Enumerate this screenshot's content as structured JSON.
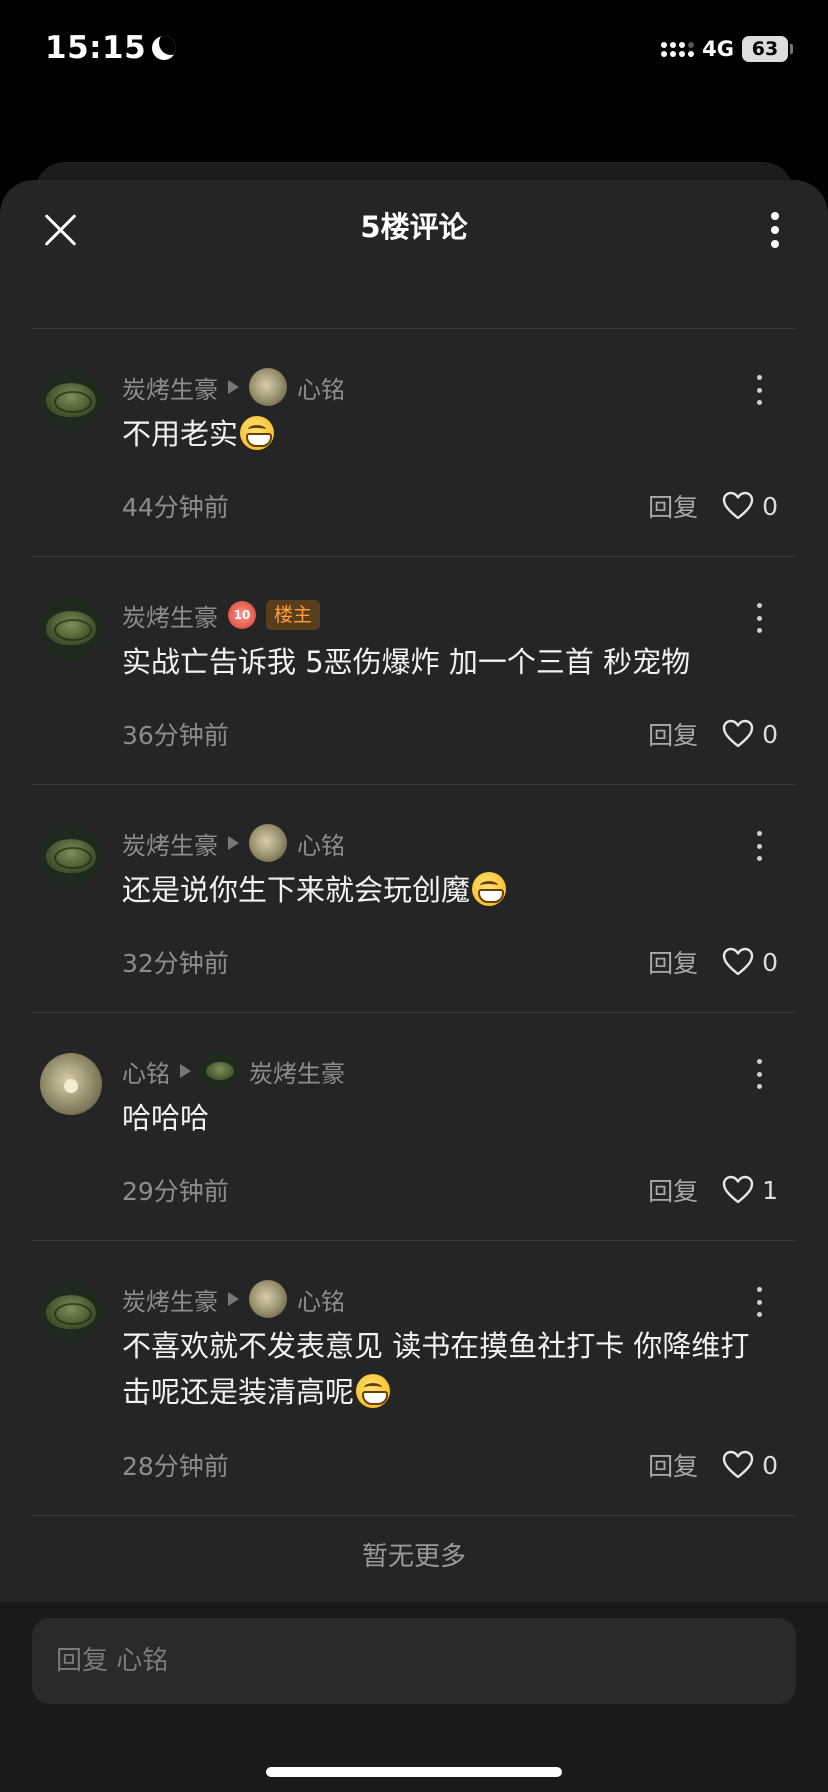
{
  "status_bar": {
    "time": "15:15",
    "network": "4G",
    "battery": "63"
  },
  "header": {
    "title": "5楼评论"
  },
  "comments": [
    {
      "author": "炭烤生豪",
      "reply_to": "心铭",
      "text": "不用老实",
      "emoji": "grin-icon",
      "time": "44分钟前",
      "reply_label": "回复",
      "likes": "0"
    },
    {
      "author": "炭烤生豪",
      "level": "10",
      "badge": "楼主",
      "text": "实战亡告诉我 5恶伤爆炸 加一个三首 秒宠物",
      "time": "36分钟前",
      "reply_label": "回复",
      "likes": "0"
    },
    {
      "author": "炭烤生豪",
      "reply_to": "心铭",
      "text": "还是说你生下来就会玩创魔",
      "emoji": "grin-icon",
      "time": "32分钟前",
      "reply_label": "回复",
      "likes": "0"
    },
    {
      "author": "心铭",
      "reply_to": "炭烤生豪",
      "text": "哈哈哈",
      "time": "29分钟前",
      "reply_label": "回复",
      "likes": "1"
    },
    {
      "author": "炭烤生豪",
      "reply_to": "心铭",
      "text": "不喜欢就不发表意见 读书在摸鱼社打卡 你降维打击呢还是装清高呢",
      "emoji": "grin-icon",
      "time": "28分钟前",
      "reply_label": "回复",
      "likes": "0"
    }
  ],
  "end_text": "暂无更多",
  "reply_input": {
    "placeholder": "回复 心铭"
  }
}
